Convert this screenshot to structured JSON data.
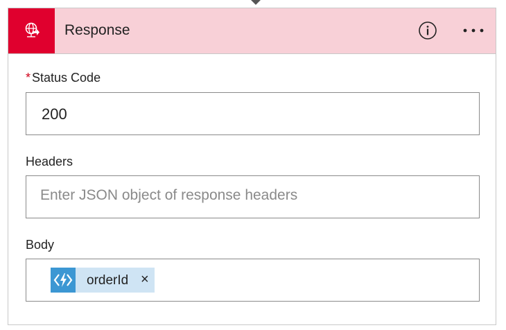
{
  "action": {
    "title": "Response",
    "icon": "globe-response-icon",
    "accent_color": "#e0002e",
    "header_color": "#f8d0d7"
  },
  "header_icons": {
    "info": "info-icon",
    "more": "more-options-icon"
  },
  "fields": {
    "status_code": {
      "required_marker": "*",
      "label": "Status Code",
      "value": "200"
    },
    "headers": {
      "label": "Headers",
      "placeholder": "Enter JSON object of response headers"
    },
    "body": {
      "label": "Body",
      "token": {
        "label": "orderId",
        "icon": "azure-function-icon",
        "remove": "×"
      }
    }
  }
}
